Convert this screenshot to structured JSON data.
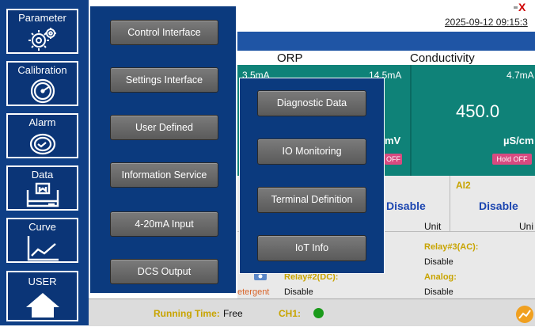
{
  "sidebar": {
    "items": [
      {
        "label": "Parameter",
        "icon": "gears-icon"
      },
      {
        "label": "Calibration",
        "icon": "gauge-icon"
      },
      {
        "label": "Alarm",
        "icon": "alarm-clock-icon"
      },
      {
        "label": "Data",
        "icon": "data-storage-icon"
      },
      {
        "label": "Curve",
        "icon": "trend-curve-icon"
      },
      {
        "label": "USER",
        "icon": "home-icon"
      }
    ]
  },
  "menu_primary": {
    "items": [
      "Control Interface",
      "Settings Interface",
      "User Defined",
      "Information Service",
      "4-20mA Input",
      "DCS Output"
    ]
  },
  "menu_secondary": {
    "items": [
      "Diagnostic Data",
      "IO Monitoring",
      "Terminal Definition",
      "IoT Info"
    ]
  },
  "background_screen": {
    "datetime": "2025-09-12 09:15:3",
    "close_glyph": "X",
    "headers": [
      "ORP",
      "Conductivity"
    ],
    "channels": [
      {
        "current": "3.5mA"
      },
      {
        "current": "14.5mA",
        "unit": "mV",
        "hold": "OFF"
      },
      {
        "current": "4.7mA",
        "value": "450.0",
        "unit": "µS/cm",
        "hold": "Hold OFF"
      }
    ],
    "ai_label": "AI2",
    "disable_a": "Disable",
    "disable_b": "Disable",
    "unit_a": "Unit",
    "unit_b": "Uni",
    "relay3_label": "Relay#3(AC):",
    "relay3_value": "Disable",
    "relay2_label": "Relay#2(DC):",
    "relay2_value": "Disable",
    "analog_label": "Analog:",
    "analog_value": "Disable",
    "detergent": "etergent"
  },
  "status": {
    "running_label": "Running Time:",
    "running_value": "Free",
    "ch1_label": "CH1:",
    "colors": {
      "ch1_indicator": "#1a9a1a",
      "chart_icon": "#f0a020"
    }
  },
  "colors": {
    "sidebar_bg": "#0f3f86",
    "menu_bg": "#0b3a7e",
    "teal_panel": "#0f8278",
    "bluebar": "#1f55a5",
    "button_gray": "#666666",
    "hold_button": "#d84a80"
  }
}
